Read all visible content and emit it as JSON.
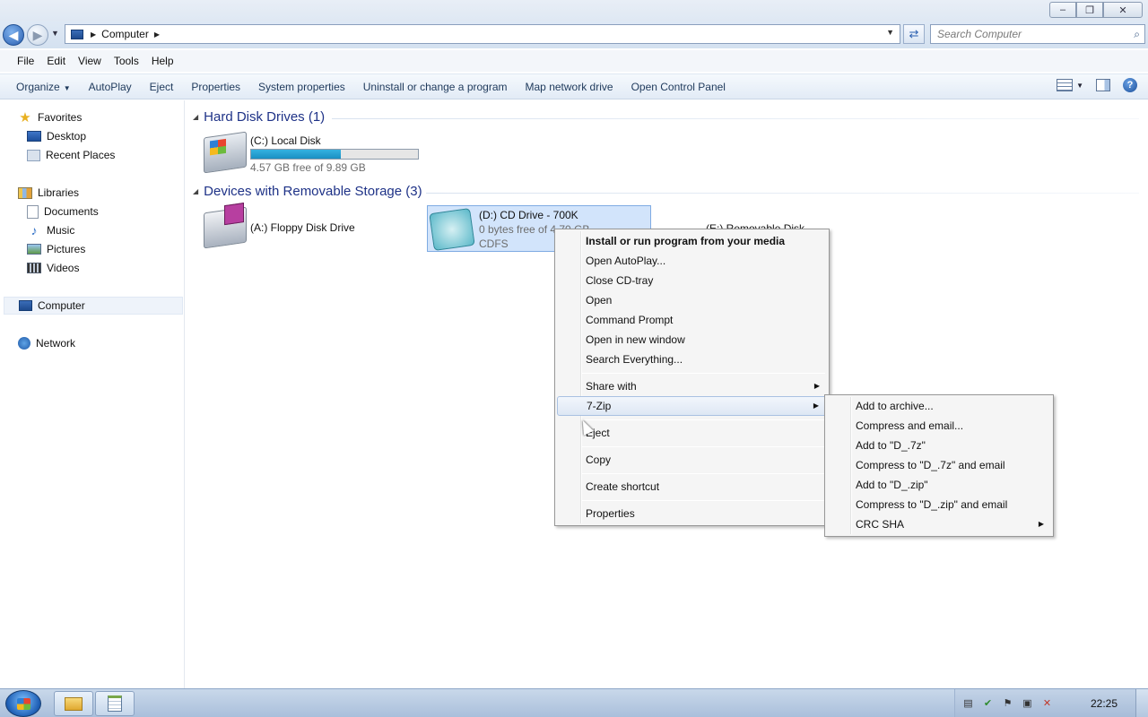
{
  "window": {
    "minimize_glyph": "–",
    "maximize_glyph": "❐",
    "close_glyph": "✕"
  },
  "address": {
    "path": "Computer",
    "search_placeholder": "Search Computer"
  },
  "menubar": [
    {
      "label": "File"
    },
    {
      "label": "Edit"
    },
    {
      "label": "View"
    },
    {
      "label": "Tools"
    },
    {
      "label": "Help"
    }
  ],
  "commandbar": [
    "Organize",
    "AutoPlay",
    "Eject",
    "Properties",
    "System properties",
    "Uninstall or change a program",
    "Map network drive",
    "Open Control Panel"
  ],
  "navpane": {
    "favorites": "Favorites",
    "desktop": "Desktop",
    "recent_places": "Recent Places",
    "libraries": "Libraries",
    "documents": "Documents",
    "music": "Music",
    "pictures": "Pictures",
    "videos": "Videos",
    "computer": "Computer",
    "network": "Network"
  },
  "content": {
    "group_hdd": "Hard Disk Drives (1)",
    "group_removable": "Devices with Removable Storage (3)",
    "drive_c": {
      "name": "(C:) Local Disk",
      "free": "4.57 GB free of 9.89 GB",
      "used_fraction": 0.54
    },
    "drive_a": {
      "name": "(A:) Floppy Disk Drive"
    },
    "drive_d": {
      "name": "(D:) CD Drive - 700K",
      "free": "0 bytes free of 4.70 GB",
      "fs": "CDFS"
    },
    "drive_e": {
      "name": "(E:) Removable Disk"
    }
  },
  "context_menu": {
    "items": [
      "Install or run program from your media",
      "Open AutoPlay...",
      "Close CD-tray",
      "Open",
      "Command Prompt",
      "Open in new window",
      "Search Everything...",
      "Share with",
      "7-Zip",
      "Eject",
      "Copy",
      "Create shortcut",
      "Properties"
    ]
  },
  "submenu_7zip": {
    "items": [
      "Add to archive...",
      "Compress and email...",
      "Add to \"D_.7z\"",
      "Compress to \"D_.7z\" and email",
      "Add to \"D_.zip\"",
      "Compress to \"D_.zip\" and email",
      "CRC SHA"
    ]
  },
  "taskbar": {
    "clock": "22:25"
  }
}
